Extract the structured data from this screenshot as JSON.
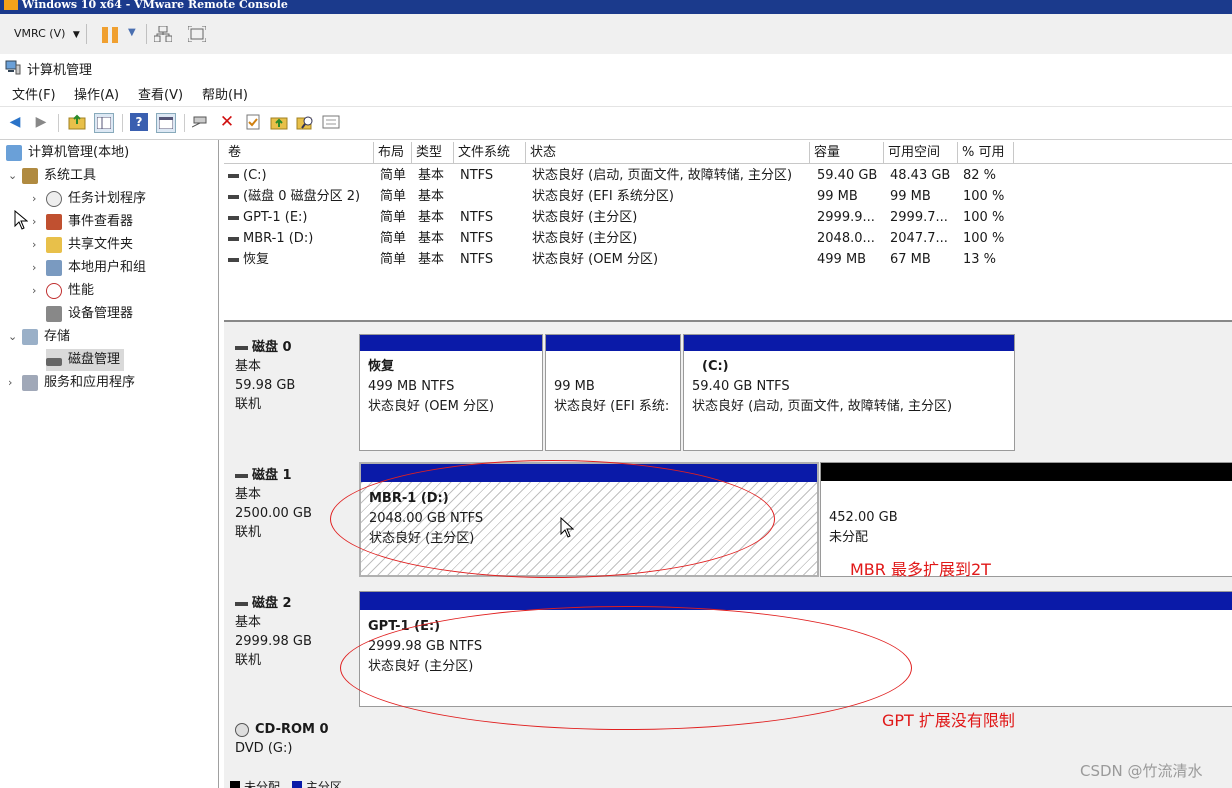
{
  "vmrc": {
    "title": "Windows 10 x64 - VMware Remote Console",
    "menu_label": "VMRC (V)"
  },
  "app": {
    "title": "计算机管理"
  },
  "menubar": [
    "文件(F)",
    "操作(A)",
    "查看(V)",
    "帮助(H)"
  ],
  "toolbar_icons": [
    "back-arrow-icon",
    "forward-arrow-icon",
    "up-folder-icon",
    "show-hide-tree-icon",
    "help-icon",
    "console-view-icon",
    "connect-icon",
    "delete-icon",
    "check-icon",
    "folder-up-icon",
    "search-folder-icon",
    "properties-icon"
  ],
  "tree": {
    "root": "计算机管理(本地)",
    "system_tools": "系统工具",
    "task_scheduler": "任务计划程序",
    "event_viewer": "事件查看器",
    "shared_folders": "共享文件夹",
    "local_users": "本地用户和组",
    "performance": "性能",
    "device_manager": "设备管理器",
    "storage": "存储",
    "disk_management": "磁盘管理",
    "services_apps": "服务和应用程序"
  },
  "volumes": {
    "columns": [
      "卷",
      "布局",
      "类型",
      "文件系统",
      "状态",
      "容量",
      "可用空间",
      "% 可用"
    ],
    "rows": [
      {
        "volume": "(C:)",
        "layout": "简单",
        "type": "基本",
        "fs": "NTFS",
        "status": "状态良好 (启动, 页面文件, 故障转储, 主分区)",
        "capacity": "59.40 GB",
        "free": "48.43 GB",
        "pct": "82 %"
      },
      {
        "volume": "(磁盘 0 磁盘分区 2)",
        "layout": "简单",
        "type": "基本",
        "fs": "",
        "status": "状态良好 (EFI 系统分区)",
        "capacity": "99 MB",
        "free": "99 MB",
        "pct": "100 %"
      },
      {
        "volume": "GPT-1 (E:)",
        "layout": "简单",
        "type": "基本",
        "fs": "NTFS",
        "status": "状态良好 (主分区)",
        "capacity": "2999.9...",
        "free": "2999.7...",
        "pct": "100 %"
      },
      {
        "volume": "MBR-1 (D:)",
        "layout": "简单",
        "type": "基本",
        "fs": "NTFS",
        "status": "状态良好 (主分区)",
        "capacity": "2048.0...",
        "free": "2047.7...",
        "pct": "100 %"
      },
      {
        "volume": "恢复",
        "layout": "简单",
        "type": "基本",
        "fs": "NTFS",
        "status": "状态良好 (OEM 分区)",
        "capacity": "499 MB",
        "free": "67 MB",
        "pct": "13 %"
      }
    ]
  },
  "disks": {
    "disk0": {
      "name": "磁盘 0",
      "type": "基本",
      "size": "59.98 GB",
      "state": "联机",
      "parts": [
        {
          "title": "恢复",
          "line1": "499 MB NTFS",
          "line2": "状态良好 (OEM 分区)"
        },
        {
          "title": "",
          "line1": "99 MB",
          "line2": "状态良好 (EFI 系统:"
        },
        {
          "title": "(C:)",
          "line1": "59.40 GB NTFS",
          "line2": "状态良好 (启动, 页面文件, 故障转储, 主分区)"
        }
      ]
    },
    "disk1": {
      "name": "磁盘 1",
      "type": "基本",
      "size": "2500.00 GB",
      "state": "联机",
      "parts": [
        {
          "title": "MBR-1  (D:)",
          "line1": "2048.00 GB NTFS",
          "line2": "状态良好 (主分区)"
        },
        {
          "title": "",
          "line1": "452.00 GB",
          "line2": "未分配"
        }
      ]
    },
    "disk2": {
      "name": "磁盘 2",
      "type": "基本",
      "size": "2999.98 GB",
      "state": "联机",
      "parts": [
        {
          "title": "GPT-1  (E:)",
          "line1": "2999.98 GB NTFS",
          "line2": "状态良好 (主分区)"
        }
      ]
    },
    "cdrom0": {
      "name": "CD-ROM 0",
      "type": "DVD (G:)"
    }
  },
  "legend": [
    "未分配",
    "主分区"
  ],
  "annotations": {
    "mbr_note": "MBR 最多扩展到2T",
    "gpt_note": "GPT 扩展没有限制",
    "annotation_color": "#e01818"
  },
  "watermark": "CSDN @竹流清水",
  "colors": {
    "primary_partition": "#0a1aa8",
    "unallocated": "#000000",
    "vm_title_bg": "#1b3a8c"
  }
}
